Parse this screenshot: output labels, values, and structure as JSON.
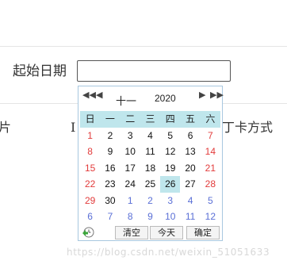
{
  "form": {
    "start_label": "起始日期",
    "date_input_value": ""
  },
  "background": {
    "left_fragment": "片",
    "mid_fragment": "I",
    "right_fragment": "丁卡方式"
  },
  "calendar": {
    "nav": {
      "prev_year": "◀◀",
      "prev_month": "◀",
      "next_month": "▶",
      "next_year": "▶▶"
    },
    "month": "十一",
    "year": "2020",
    "weekdays": [
      "日",
      "一",
      "二",
      "三",
      "四",
      "五",
      "六"
    ],
    "weeks": [
      [
        {
          "d": "1",
          "type": "weekend"
        },
        {
          "d": "2"
        },
        {
          "d": "3"
        },
        {
          "d": "4"
        },
        {
          "d": "5"
        },
        {
          "d": "6"
        },
        {
          "d": "7",
          "type": "weekend"
        }
      ],
      [
        {
          "d": "8",
          "type": "weekend"
        },
        {
          "d": "9"
        },
        {
          "d": "10"
        },
        {
          "d": "11"
        },
        {
          "d": "12"
        },
        {
          "d": "13"
        },
        {
          "d": "14",
          "type": "weekend"
        }
      ],
      [
        {
          "d": "15",
          "type": "weekend"
        },
        {
          "d": "16"
        },
        {
          "d": "17"
        },
        {
          "d": "18"
        },
        {
          "d": "19"
        },
        {
          "d": "20"
        },
        {
          "d": "21",
          "type": "weekend"
        }
      ],
      [
        {
          "d": "22",
          "type": "weekend"
        },
        {
          "d": "23"
        },
        {
          "d": "24"
        },
        {
          "d": "25"
        },
        {
          "d": "26",
          "type": "today"
        },
        {
          "d": "27"
        },
        {
          "d": "28",
          "type": "weekend"
        }
      ],
      [
        {
          "d": "29",
          "type": "weekend"
        },
        {
          "d": "30"
        },
        {
          "d": "1",
          "type": "other"
        },
        {
          "d": "2",
          "type": "other"
        },
        {
          "d": "3",
          "type": "other"
        },
        {
          "d": "4",
          "type": "other"
        },
        {
          "d": "5",
          "type": "other"
        }
      ],
      [
        {
          "d": "6",
          "type": "other"
        },
        {
          "d": "7",
          "type": "other"
        },
        {
          "d": "8",
          "type": "other"
        },
        {
          "d": "9",
          "type": "other"
        },
        {
          "d": "10",
          "type": "other"
        },
        {
          "d": "11",
          "type": "other"
        },
        {
          "d": "12",
          "type": "other"
        }
      ]
    ],
    "footer": {
      "clear": "清空",
      "today": "今天",
      "ok": "确定",
      "time_icon": "clock-icon"
    },
    "colors": {
      "header_bg": "#bfe6ec",
      "today_bg": "#bfe6ec",
      "weekend": "#e23b3b",
      "other_month": "#5a6fd6",
      "border": "#a8c8e0"
    }
  },
  "watermark": "https://blog.csdn.net/weixin_51051633"
}
